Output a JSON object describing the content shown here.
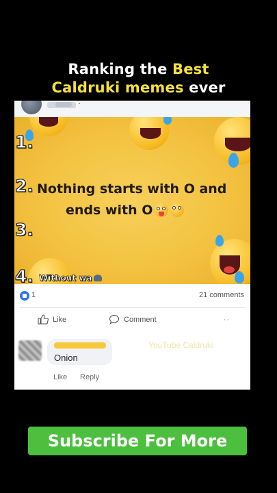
{
  "headline": {
    "line1_plain": "Ranking the ",
    "line1_highlight": "Best",
    "line2_highlight": "Caldruki memes",
    "line2_plain": " ever",
    "highlight_color": "#f6e23a"
  },
  "meme": {
    "rank1": "1.",
    "rank2": "2.",
    "rank3": "3.",
    "rank4": "4.",
    "line_a": "Nothing starts with O and",
    "line_b": "ends with O",
    "caption4": "Without wa",
    "emojis": [
      "tongue-out-emoji",
      "eye-roll-emoji",
      "laughing-emoji"
    ]
  },
  "post": {
    "reaction_count": "1",
    "comments_count": "21 comments",
    "like_label": "Like",
    "comment_label": "Comment"
  },
  "comment": {
    "text": "Onion",
    "like_label": "Like",
    "reply_label": "Reply"
  },
  "watermark": "YouTube Caldruki",
  "subscribe_label": "Subscribe For More",
  "colors": {
    "background": "#000000",
    "meme_yellow": "#f3c13f",
    "subscribe_green": "#4cbf3e",
    "like_blue": "#2f77ea"
  }
}
